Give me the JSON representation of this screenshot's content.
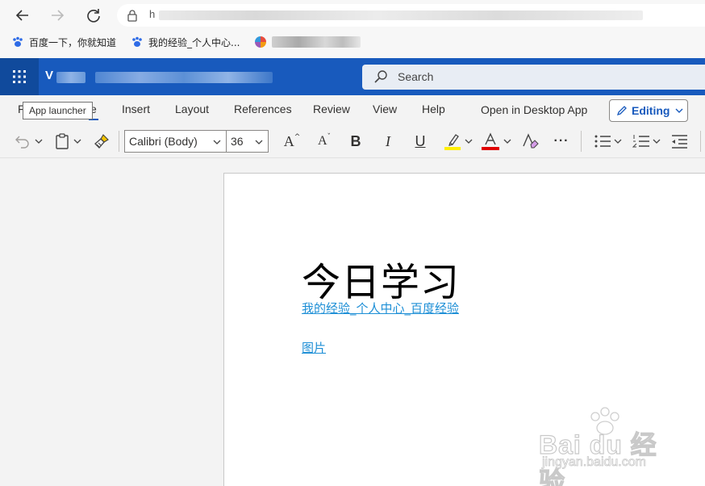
{
  "browser": {
    "address_text": "h",
    "bookmarks": [
      {
        "label": "百度一下，你就知道",
        "icon": "baidu-paw-icon"
      },
      {
        "label": "我的经验_个人中心...",
        "icon": "baidu-paw-icon"
      },
      {
        "label": "",
        "icon": "colorful-pinwheel-icon"
      }
    ]
  },
  "office": {
    "app_name": "V",
    "search_placeholder": "Search"
  },
  "ribbon": {
    "tooltip": "App launcher",
    "tabs": {
      "file": "F",
      "home": "e",
      "insert": "Insert",
      "layout": "Layout",
      "references": "References",
      "review": "Review",
      "view": "View",
      "help": "Help"
    },
    "open_desktop": "Open in Desktop App",
    "editing": "Editing",
    "font_name": "Calibri (Body)",
    "font_size": "36",
    "grow_font": "A",
    "shrink_font": "A",
    "bold": "B",
    "italic": "I",
    "underline": "U",
    "more": "···"
  },
  "document": {
    "title": "今日学习",
    "link1": "我的经验_个人中心_百度经验",
    "link2": "图片"
  },
  "watermark": {
    "main": "Bai du 经验",
    "sub": "jingyan.baidu.com"
  },
  "colors": {
    "brand_blue": "#185abd",
    "waffle_blue": "#104a9c",
    "link_blue": "#1e8fd6",
    "highlight_yellow": "#ffef00",
    "font_color_red": "#e00000"
  }
}
